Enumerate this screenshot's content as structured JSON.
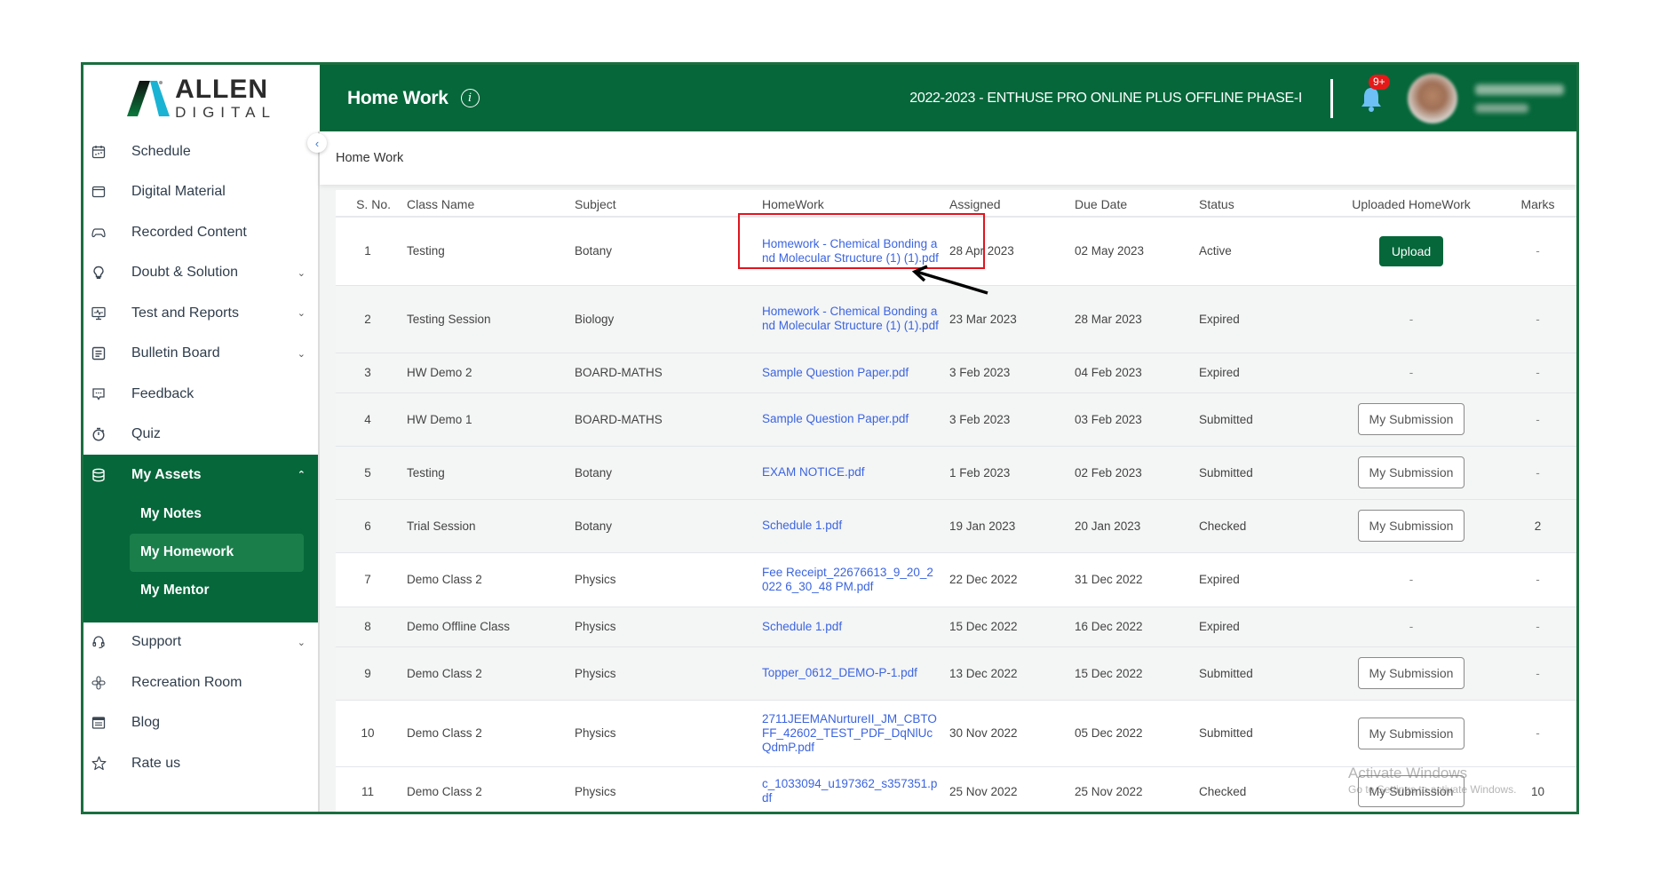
{
  "brand": {
    "name_top": "ALLEN",
    "name_bottom": "DIGITAL"
  },
  "header": {
    "title": "Home Work",
    "course": "2022-2023 - ENTHUSE PRO ONLINE PLUS OFFLINE PHASE-I",
    "notification_badge": "9+",
    "accent_color": "#05673a"
  },
  "sidebar": {
    "collapse_icon": "chevron-left-icon",
    "items": [
      {
        "label": "Schedule",
        "icon": "calendar-icon",
        "has_chevron": false
      },
      {
        "label": "Digital Material",
        "icon": "folder-icon",
        "has_chevron": false
      },
      {
        "label": "Recorded Content",
        "icon": "gamepad-icon",
        "has_chevron": false
      },
      {
        "label": "Doubt & Solution",
        "icon": "lightbulb-icon",
        "has_chevron": true
      },
      {
        "label": "Test and Reports",
        "icon": "monitor-pulse-icon",
        "has_chevron": true
      },
      {
        "label": "Bulletin Board",
        "icon": "notice-icon",
        "has_chevron": true
      },
      {
        "label": "Feedback",
        "icon": "chat-bubble-icon",
        "has_chevron": false
      },
      {
        "label": "Quiz",
        "icon": "stopwatch-icon",
        "has_chevron": false
      }
    ],
    "assets": {
      "label": "My Assets",
      "icon": "database-icon",
      "expanded": true,
      "children": [
        {
          "label": "My Notes",
          "active": false
        },
        {
          "label": "My Homework",
          "active": true
        },
        {
          "label": "My Mentor",
          "active": false
        }
      ]
    },
    "bottom_items": [
      {
        "label": "Support",
        "icon": "headset-icon",
        "has_chevron": true
      },
      {
        "label": "Recreation Room",
        "icon": "recreation-icon",
        "has_chevron": false
      },
      {
        "label": "Blog",
        "icon": "blog-icon",
        "has_chevron": false
      },
      {
        "label": "Rate us",
        "icon": "star-icon",
        "has_chevron": false
      }
    ]
  },
  "breadcrumb": "Home Work",
  "table": {
    "columns": [
      "S. No.",
      "Class Name",
      "Subject",
      "HomeWork",
      "Assigned",
      "Due Date",
      "Status",
      "Uploaded HomeWork",
      "Marks"
    ],
    "rows": [
      {
        "sno": "1",
        "class": "Testing",
        "subject": "Botany",
        "homework": "Homework - Chemical Bonding and Molecular Structure (1) (1).pdf",
        "assigned": "28 Apr 2023",
        "due": "02 May 2023",
        "status": "Active",
        "upload": "Upload",
        "marks": "-",
        "shade": false
      },
      {
        "sno": "2",
        "class": "Testing Session",
        "subject": "Biology",
        "homework": "Homework - Chemical Bonding and Molecular Structure (1) (1).pdf",
        "assigned": "23 Mar 2023",
        "due": "28 Mar 2023",
        "status": "Expired",
        "upload": "-",
        "marks": "-",
        "shade": true
      },
      {
        "sno": "3",
        "class": "HW Demo 2",
        "subject": "BOARD-MATHS",
        "homework": "Sample Question Paper.pdf",
        "assigned": "3 Feb 2023",
        "due": "04 Feb 2023",
        "status": "Expired",
        "upload": "-",
        "marks": "-",
        "shade": true
      },
      {
        "sno": "4",
        "class": "HW Demo 1",
        "subject": "BOARD-MATHS",
        "homework": "Sample Question Paper.pdf",
        "assigned": "3 Feb 2023",
        "due": "03 Feb 2023",
        "status": "Submitted",
        "upload": "My Submission",
        "marks": "-",
        "shade": true
      },
      {
        "sno": "5",
        "class": "Testing",
        "subject": "Botany",
        "homework": "EXAM NOTICE.pdf",
        "assigned": "1 Feb 2023",
        "due": "02 Feb 2023",
        "status": "Submitted",
        "upload": "My Submission",
        "marks": "-",
        "shade": true
      },
      {
        "sno": "6",
        "class": "Trial Session",
        "subject": "Botany",
        "homework": "Schedule 1.pdf",
        "assigned": "19 Jan 2023",
        "due": "20 Jan 2023",
        "status": "Checked",
        "upload": "My Submission",
        "marks": "2",
        "shade": true
      },
      {
        "sno": "7",
        "class": "Demo Class 2",
        "subject": "Physics",
        "homework": "Fee Receipt_22676613_9_20_2022 6_30_48 PM.pdf",
        "assigned": "22 Dec 2022",
        "due": "31 Dec 2022",
        "status": "Expired",
        "upload": "-",
        "marks": "-",
        "shade": false
      },
      {
        "sno": "8",
        "class": "Demo Offline Class",
        "subject": "Physics",
        "homework": "Schedule 1.pdf",
        "assigned": "15 Dec 2022",
        "due": "16 Dec 2022",
        "status": "Expired",
        "upload": "-",
        "marks": "-",
        "shade": true
      },
      {
        "sno": "9",
        "class": "Demo Class 2",
        "subject": "Physics",
        "homework": "Topper_0612_DEMO-P-1.pdf",
        "assigned": "13 Dec 2022",
        "due": "15 Dec 2022",
        "status": "Submitted",
        "upload": "My Submission",
        "marks": "-",
        "shade": true
      },
      {
        "sno": "10",
        "class": "Demo Class 2",
        "subject": "Physics",
        "homework": "2711JEEMANurtureII_JM_CBTOFF_42602_TEST_PDF_DqNlUcQdmP.pdf",
        "assigned": "30 Nov 2022",
        "due": "05 Dec 2022",
        "status": "Submitted",
        "upload": "My Submission",
        "marks": "-",
        "shade": false
      },
      {
        "sno": "11",
        "class": "Demo Class 2",
        "subject": "Physics",
        "homework": "c_1033094_u197362_s357351.pdf",
        "assigned": "25 Nov 2022",
        "due": "25 Nov 2022",
        "status": "Checked",
        "upload": "My Submission",
        "marks": "10",
        "shade": false
      }
    ]
  },
  "watermark": {
    "line1": "Activate Windows",
    "line2": "Go to Settings to activate Windows."
  },
  "annotation": {
    "highlight_color": "#e0141e",
    "arrow_color": "#000000"
  }
}
